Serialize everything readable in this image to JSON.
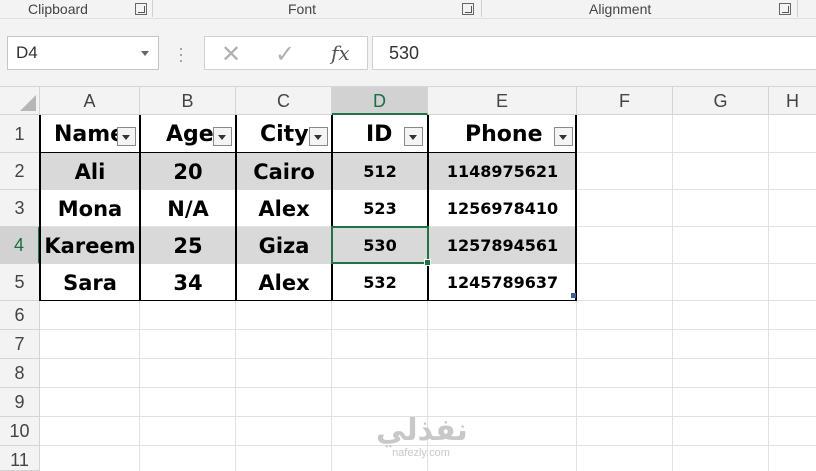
{
  "ribbon": {
    "groups": [
      {
        "label": "Clipboard"
      },
      {
        "label": "Font"
      },
      {
        "label": "Alignment"
      }
    ]
  },
  "formula_bar": {
    "name_box": "D4",
    "cancel_glyph": "✕",
    "enter_glyph": "✓",
    "fx_label": "fx",
    "value": "530"
  },
  "columns": [
    "A",
    "B",
    "C",
    "D",
    "E",
    "F",
    "G",
    "H"
  ],
  "rows": [
    "1",
    "2",
    "3",
    "4",
    "5",
    "6",
    "7",
    "8",
    "9",
    "10",
    "11"
  ],
  "active_cell": "D4",
  "table": {
    "headers": [
      "Name",
      "Age",
      "City",
      "ID",
      "Phone"
    ],
    "rows": [
      [
        "Ali",
        "20",
        "Cairo",
        "512",
        "1148975621"
      ],
      [
        "Mona",
        "N/A",
        "Alex",
        "523",
        "1256978410"
      ],
      [
        "Kareem",
        "25",
        "Giza",
        "530",
        "1257894561"
      ],
      [
        "Sara",
        "34",
        "Alex",
        "532",
        "1245789637"
      ]
    ],
    "shaded_rows": [
      2,
      4
    ]
  },
  "watermark": {
    "logo_text": "نفذلي",
    "url": "nafezly.com"
  },
  "colors": {
    "selection_green": "#217346",
    "band_gray": "#d9d9d9"
  }
}
